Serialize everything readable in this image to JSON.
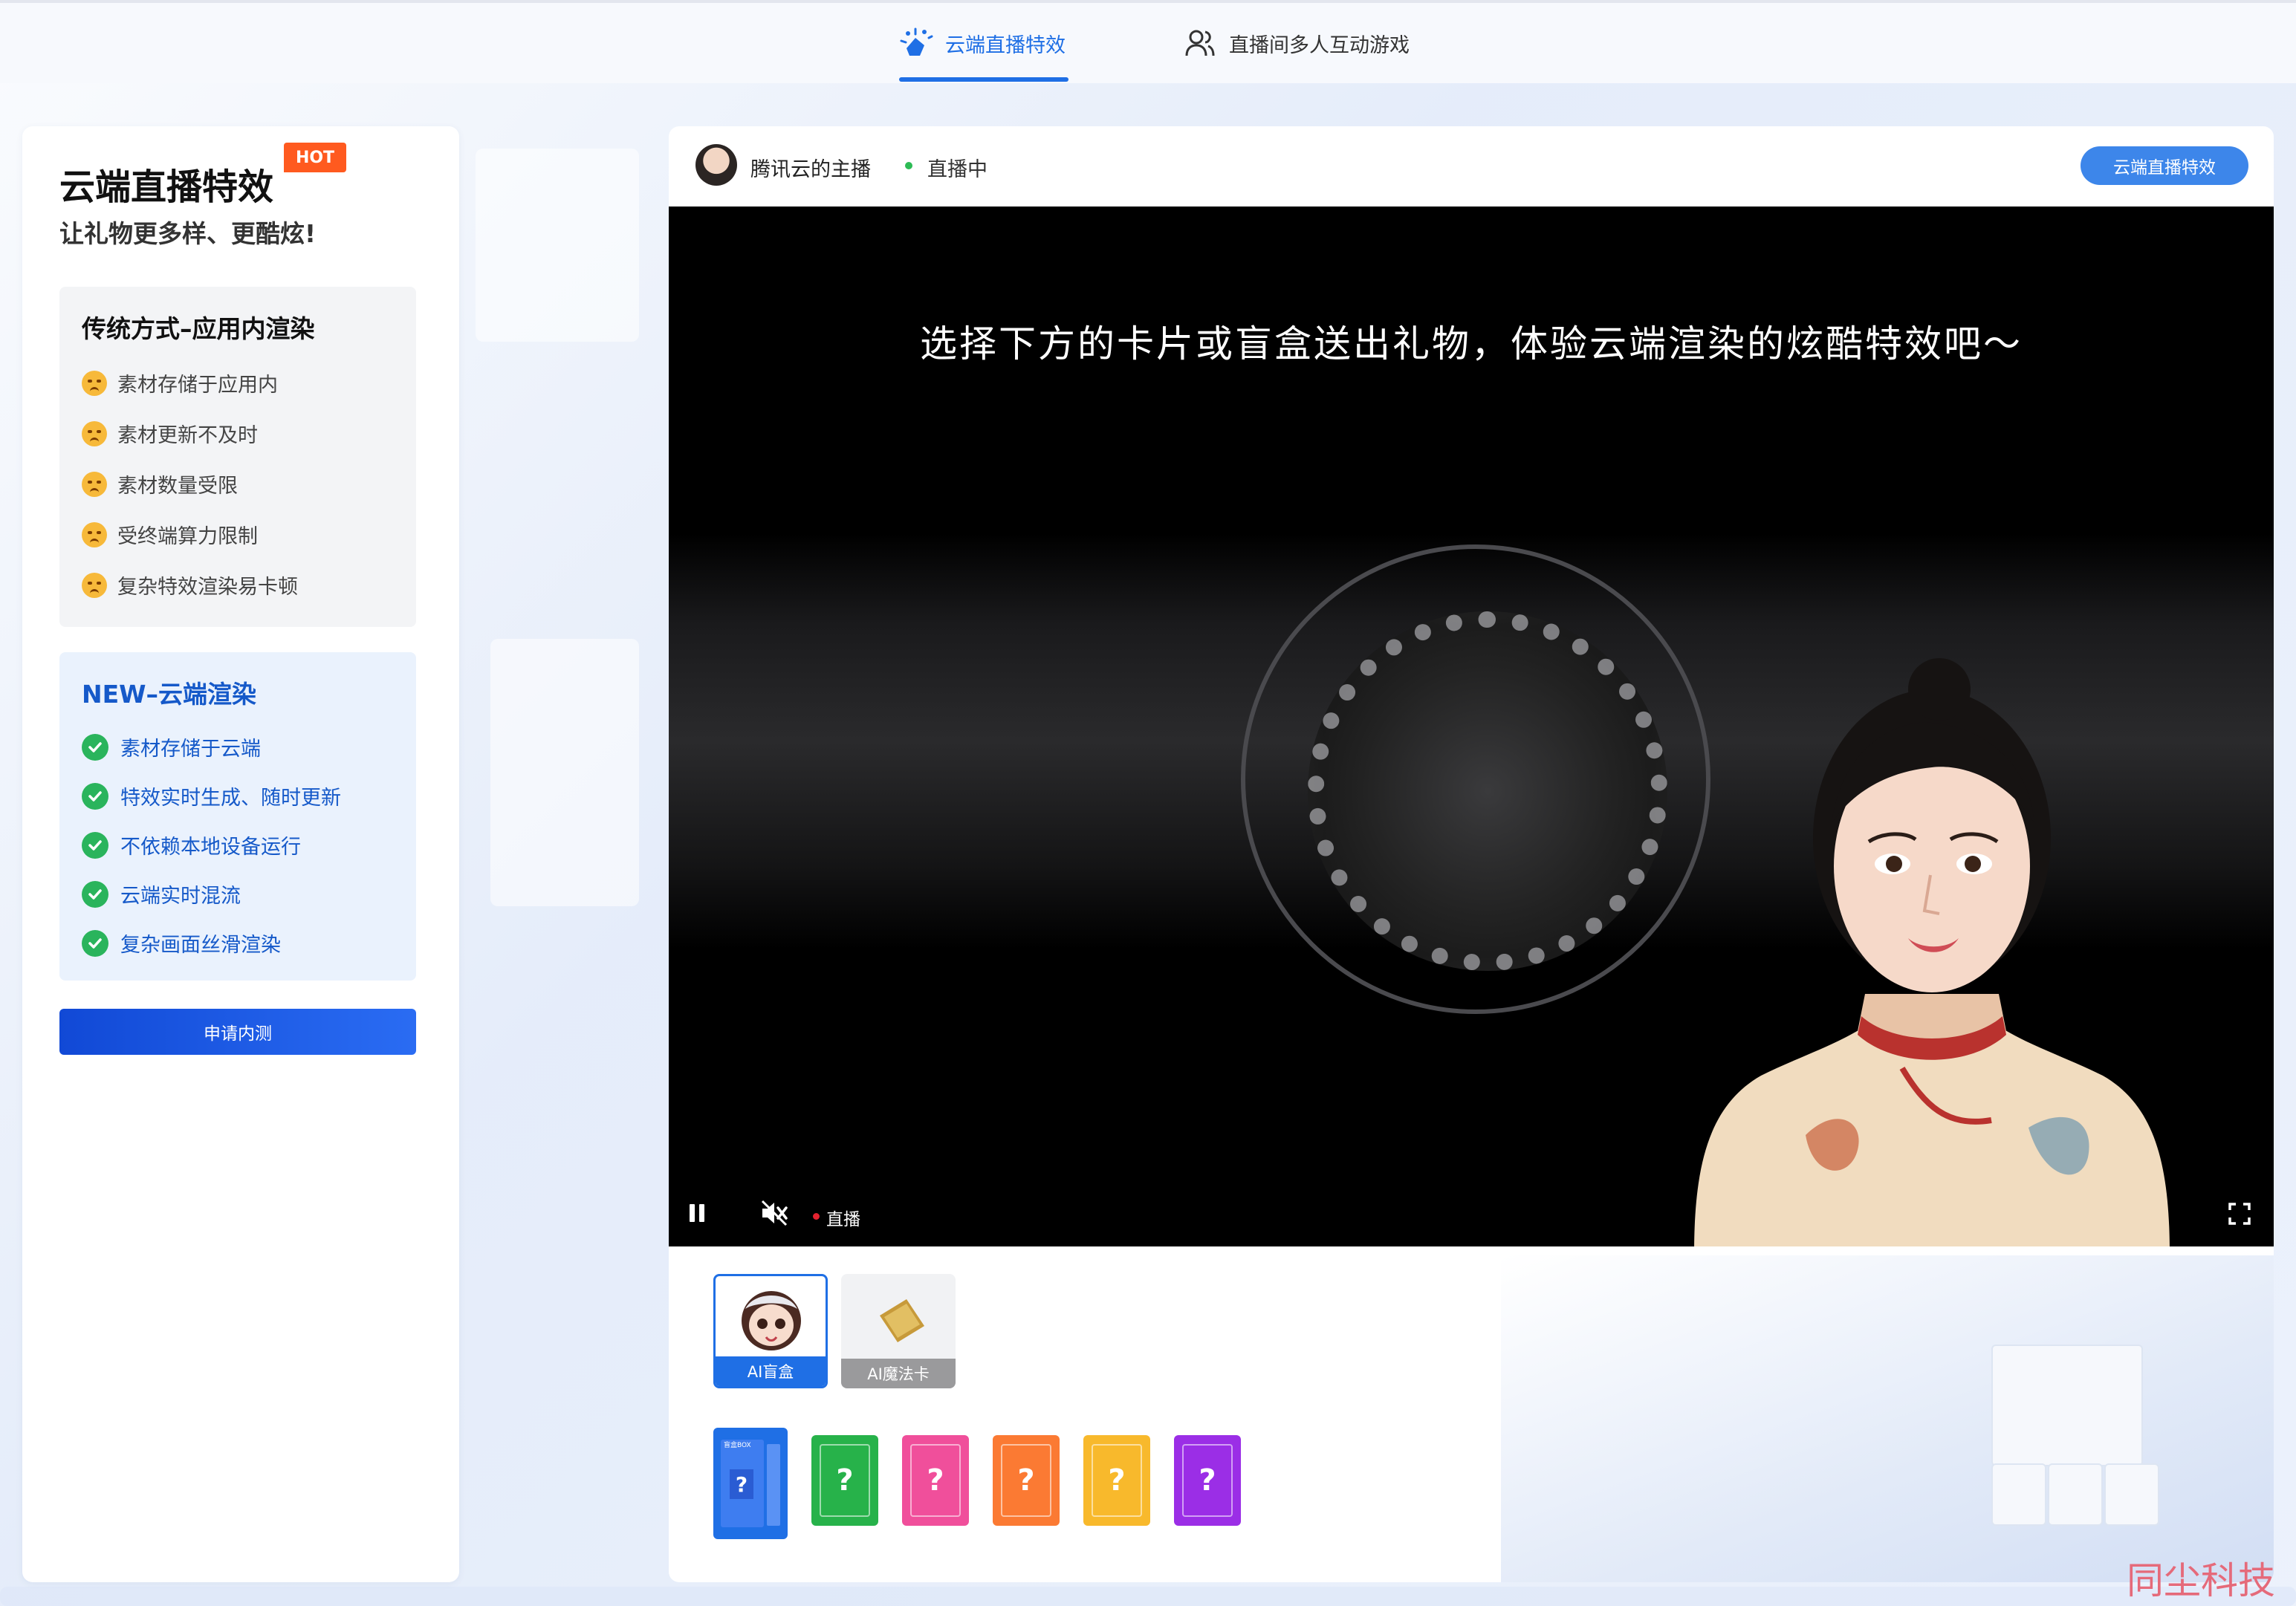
{
  "nav": {
    "tabs": [
      {
        "label": "云端直播特效",
        "icon": "sparkle-hand-icon",
        "active": true
      },
      {
        "label": "直播间多人互动游戏",
        "icon": "users-icon",
        "active": false
      }
    ]
  },
  "left_panel": {
    "title": "云端直播特效",
    "badge": "HOT",
    "subtitle": "让礼物更多样、更酷炫!",
    "old_method": {
      "title": "传统方式–应用内渲染",
      "items": [
        "素材存储于应用内",
        "素材更新不及时",
        "素材数量受限",
        "受终端算力限制",
        "复杂特效渲染易卡顿"
      ]
    },
    "new_method": {
      "title": "NEW–云端渲染",
      "items": [
        "素材存储于云端",
        "特效实时生成、随时更新",
        "不依赖本地设备运行",
        "云端实时混流",
        "复杂画面丝滑渲染"
      ]
    },
    "apply_button": "申请内测"
  },
  "stream": {
    "host_name": "腾讯云的主播",
    "status": "直播中",
    "feature_pill": "云端直播特效",
    "video_caption": "选择下方的卡片或盲盒送出礼物，体验云端渲染的炫酷特效吧～",
    "controls": {
      "live_label": "直播",
      "play_state": "playing",
      "muted": true
    }
  },
  "gifts": {
    "tabs": [
      {
        "label": "AI盲盒",
        "active": true
      },
      {
        "label": "AI魔法卡",
        "active": false
      }
    ],
    "cards": [
      {
        "symbol": "?",
        "color": "#27b24a"
      },
      {
        "symbol": "?",
        "color": "#f04f9b"
      },
      {
        "symbol": "?",
        "color": "#fb7a33"
      },
      {
        "symbol": "?",
        "color": "#f8b92c"
      },
      {
        "symbol": "?",
        "color": "#9b2ee6"
      }
    ],
    "selected_card": {
      "symbol": "?",
      "caption": "盲盒BOX"
    }
  },
  "watermark": "同尘科技",
  "colors": {
    "accent": "#1f6fe5",
    "live_green": "#2dbb55",
    "hot": "#ff5a1f"
  }
}
